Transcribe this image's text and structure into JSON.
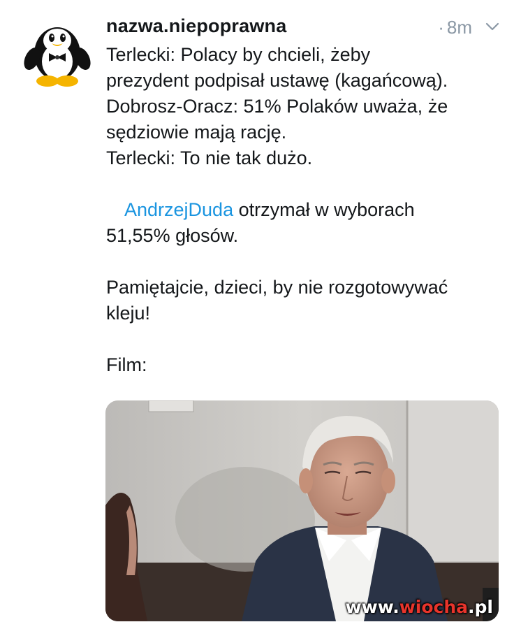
{
  "tweet": {
    "username": "nazwa.niepoprawna",
    "time": "8m",
    "time_dot": "·",
    "lines": [
      "Terlecki: Polacy by chcieli, żeby",
      "prezydent podpisał ustawę (kagańcową).",
      "Dobrosz-Oracz: 51% Polaków uważa, że",
      "sędziowie mają rację.",
      "Terlecki: To nie tak dużo."
    ],
    "mention": "AndrzejDuda",
    "mention_rest": " otrzymał w wyborach",
    "line_after_mention": "51,55% głosów.",
    "closing_lines": [
      "Pamiętajcie, dzieci, by nie rozgotowywać",
      "kleju!"
    ],
    "film_label": "Film:"
  },
  "watermark": {
    "prefix": "www.",
    "accent": "wiocha",
    "suffix": ".pl"
  },
  "colors": {
    "mention": "#1b95e0",
    "text": "#14171a",
    "muted": "#8b98a5",
    "watermark_accent": "#e8342b"
  },
  "icons": {
    "avatar": "penguin-avatar",
    "menu": "chevron-down-icon"
  }
}
